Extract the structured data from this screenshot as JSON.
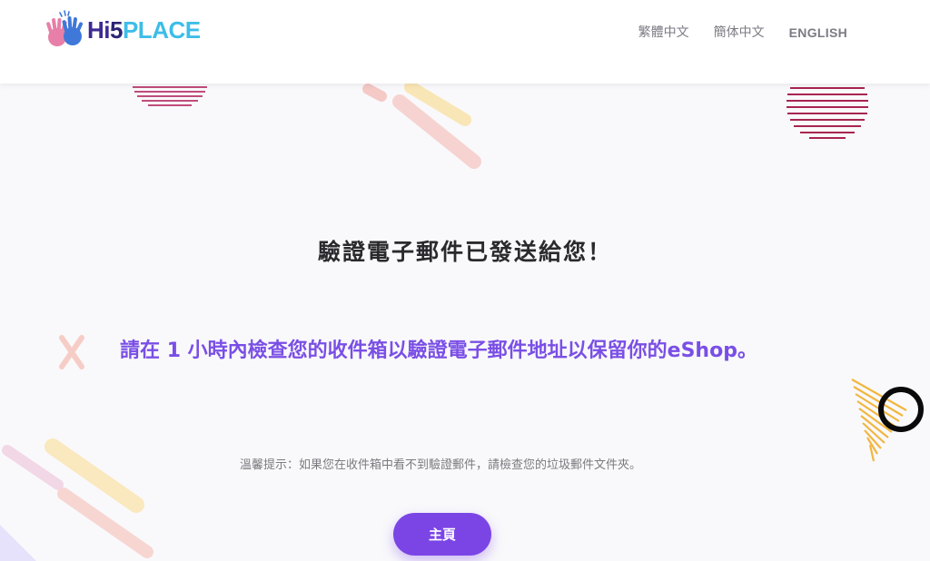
{
  "brand": {
    "logo_text_hi": "Hi",
    "logo_text_5": "5",
    "logo_text_place": "PLACE",
    "logo_icon": "waving-hands-icon"
  },
  "nav": {
    "items": [
      {
        "label": "繁體中文"
      },
      {
        "label": "簡体中文"
      },
      {
        "label": "ENGLISH"
      }
    ]
  },
  "main": {
    "title": "驗證電子郵件已發送給您！",
    "message": "請在 1 小時內檢查您的收件箱以驗證電子郵件地址以保留你的eShop。",
    "tip": "溫馨提示：如果您在收件箱中看不到驗證郵件，請檢查您的垃圾郵件文件夾。",
    "home_button": "主頁"
  },
  "colors": {
    "accent": "#7b45e6",
    "message": "#7a4fe6",
    "brand_dark": "#2b2474",
    "brand_light": "#3dbde9",
    "deco_stripes": "#a8254f",
    "deco_yellow": "#f2b640"
  }
}
